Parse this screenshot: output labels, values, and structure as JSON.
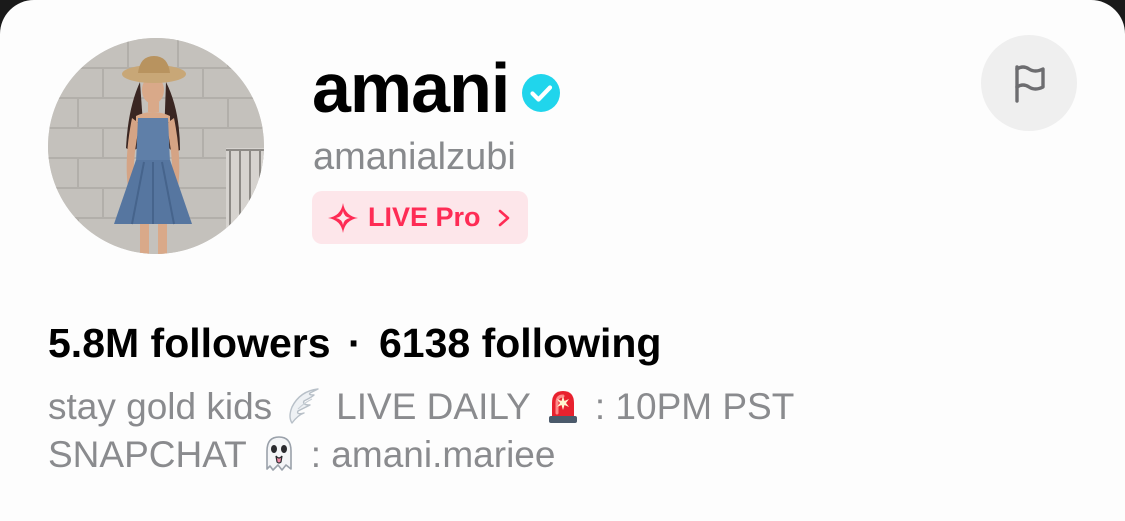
{
  "profile": {
    "display_name": "amani",
    "verified": true,
    "handle": "amanialzubi",
    "badge_label": "LIVE Pro",
    "followers": "5.8M followers",
    "separator": "·",
    "following": "6138 following",
    "bio_line1_a": "stay gold kids",
    "bio_line1_b": "LIVE DAILY",
    "bio_line1_c": ": 10PM PST",
    "bio_line2_a": "SNAPCHAT",
    "bio_line2_b": ": amani.mariee"
  },
  "icons": {
    "verified": "verified-check-icon",
    "badge": "sparkle-icon",
    "badge_arrow": "chevron-right-icon",
    "flag": "flag-icon",
    "emoji_wing": "wing-emoji",
    "emoji_siren": "siren-emoji",
    "emoji_ghost": "ghost-emoji"
  },
  "colors": {
    "verified": "#20d5ec",
    "live_pro": "#fe2c55",
    "live_pro_bg": "#fde6ea",
    "secondary_text": "#888a8d"
  }
}
